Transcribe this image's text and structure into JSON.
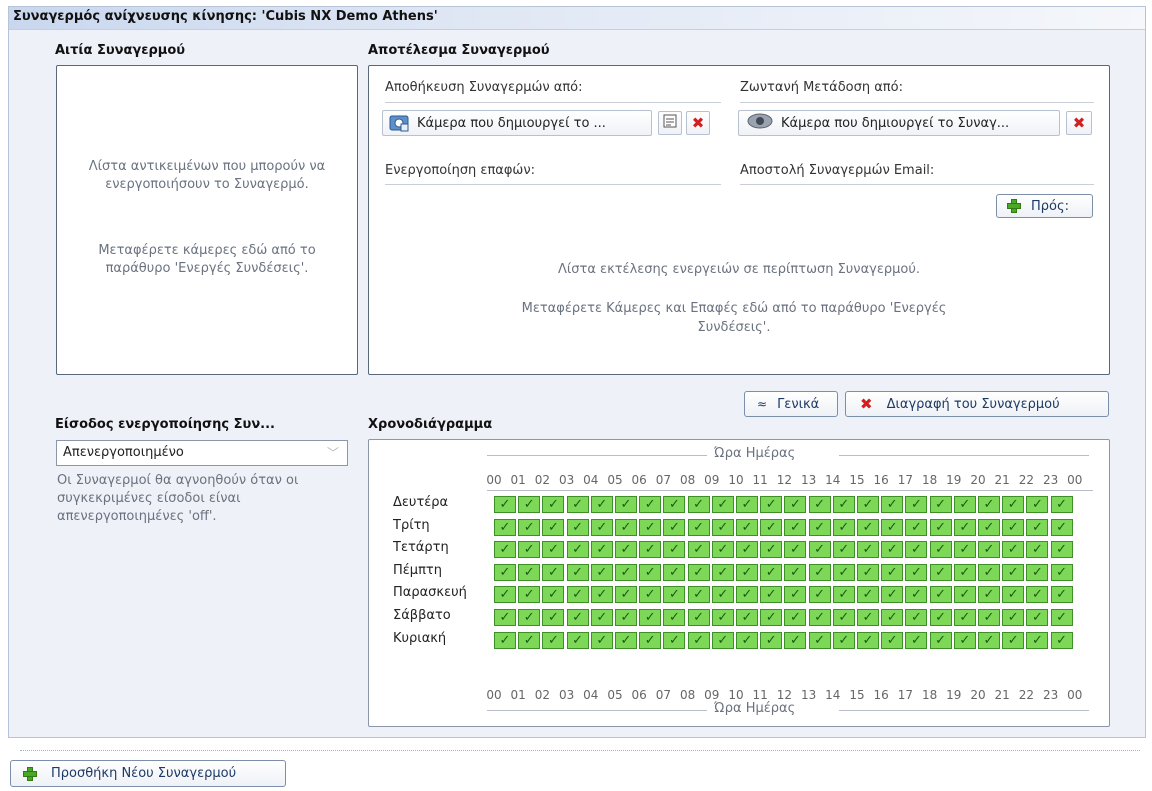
{
  "title": "Συναγερμός ανίχνευσης κίνησης: 'Cubis NX Demo Athens'",
  "cause": {
    "heading": "Αιτία Συναγερμού",
    "text1": "Λίστα αντικειμένων που μπορούν να ενεργοποιήσουν το Συναγερμό.",
    "text2": "Μεταφέρετε κάμερες εδώ από το παράθυρο 'Ενεργές Συνδέσεις'."
  },
  "result": {
    "heading": "Αποτέλεσμα Συναγερμού",
    "save_label": "Αποθήκευση Συναγερμών από:",
    "save_chip": "Κάμερα που δημιουργεί το ...",
    "live_label": "Ζωντανή Μετάδοση από:",
    "live_chip": "Κάμερα που δημιουργεί το Συναγ...",
    "contacts_label": "Ενεργοποίηση επαφών:",
    "email_label": "Αποστολή Συναγερμών Email:",
    "to_button": "Πρός:",
    "info1": "Λίστα εκτέλεσης ενεργειών σε περίπτωση Συναγερμού.",
    "info2": "Μεταφέρετε Κάμερες και Επαφές εδώ από το παράθυρο 'Ενεργές Συνδέσεις'."
  },
  "actions": {
    "general_button": "Γενικά",
    "delete_button": "Διαγραφή του Συναγερμού"
  },
  "input": {
    "heading": "Είσοδος ενεργοποίησης Συν...",
    "selected": "Απενεργοποιημένο",
    "note": "Οι Συναγερμοί θα αγνοηθούν όταν οι συγκεκριμένες είσοδοι είναι απενεργοποιημένες 'off'."
  },
  "schedule": {
    "heading": "Χρονοδιάγραμμα",
    "axis_label": "Ώρα Ημέρας",
    "hours": [
      "00",
      "01",
      "02",
      "03",
      "04",
      "05",
      "06",
      "07",
      "08",
      "09",
      "10",
      "11",
      "12",
      "13",
      "14",
      "15",
      "16",
      "17",
      "18",
      "19",
      "20",
      "21",
      "22",
      "23",
      "00"
    ],
    "days": [
      "Δευτέρα",
      "Τρίτη",
      "Τετάρτη",
      "Πέμπτη",
      "Παρασκευή",
      "Σάββατο",
      "Κυριακή"
    ],
    "all_enabled": true,
    "check_glyph": "✓"
  },
  "footer": {
    "add_button": "Προσθήκη Νέου Συναγερμού"
  },
  "colors": {
    "cell_on": "#7dd857",
    "accent": "#1d3a66",
    "delete": "#d12020",
    "add": "#49a826"
  },
  "icons": [
    "camera-save-icon",
    "properties-icon",
    "delete-icon",
    "camera-live-icon",
    "add-icon",
    "collapse-icon",
    "dropdown-arrow-icon"
  ]
}
